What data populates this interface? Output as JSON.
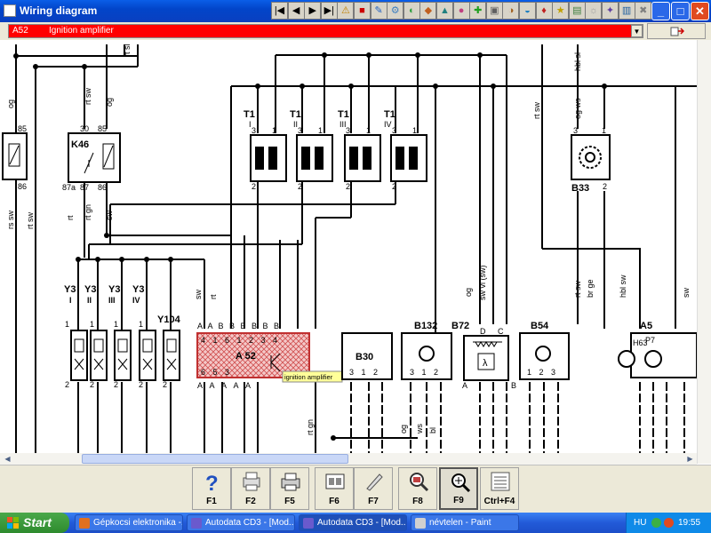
{
  "window": {
    "title": "Wiring diagram"
  },
  "toolbar": {
    "icons": [
      "first-icon",
      "prev-icon",
      "next-icon",
      "last-icon",
      "warning-icon",
      "book-icon",
      "tool-a-icon",
      "tool-b-icon",
      "tool-c-icon",
      "tool-d-icon",
      "tool-e-icon",
      "tool-f-icon",
      "tool-g-icon",
      "tool-h-icon",
      "tool-i-icon",
      "tool-j-icon",
      "tool-k-icon",
      "tool-l-icon",
      "tool-m-icon",
      "tool-n-icon",
      "tool-o-icon",
      "tool-p-icon",
      "tool-q-icon"
    ]
  },
  "selector": {
    "code": "A52",
    "label": "Ignition amplifier"
  },
  "diagram": {
    "tooltip": "ignition amplifier",
    "components": {
      "k46": "K46",
      "t1a": "T1",
      "t1a_sub": "I",
      "t1b": "T1",
      "t1b_sub": "II",
      "t1c": "T1",
      "t1c_sub": "III",
      "t1d": "T1",
      "t1d_sub": "IV",
      "b33": "B33",
      "y3a": "Y3",
      "y3a_sub": "I",
      "y3b": "Y3",
      "y3b_sub": "II",
      "y3c": "Y3",
      "y3c_sub": "III",
      "y3d": "Y3",
      "y3d_sub": "IV",
      "y104": "Y104",
      "a52": "A 52",
      "b30": "B30",
      "b132": "B132",
      "b72": "B72",
      "b54": "B54",
      "a5": "A5",
      "h63": "H63",
      "p7": "P7"
    },
    "wires": {
      "og1": "og",
      "rtsw1": "rt sw",
      "og2": "og",
      "rssw": "rs sw",
      "rtsw2": "rt sw",
      "rt1": "rt",
      "rtgn": "rt gn",
      "sw1": "sw",
      "sw2": "sw",
      "rt2": "rt",
      "rtgn2": "rt gn",
      "rtsl": "rt sl",
      "og3": "og",
      "swvi": "sw vi (sw)",
      "rtsw3": "rt sw",
      "hblsl": "hbl sl",
      "ogws": "og ws",
      "rtsw4": "rt sw",
      "brge": "br ge",
      "hblsw": "hbl sw",
      "sw3": "sw",
      "og4": "og",
      "ws": "ws",
      "bl": "bl"
    },
    "pins": {
      "k46_30": "30",
      "k46_85": "85",
      "k46_87a": "87a",
      "k46_87": "87",
      "k46_86": "86",
      "left_85": "85",
      "left_86": "86",
      "t_3": "3",
      "t_1": "1",
      "t_2": "2",
      "b33_3": "3",
      "b33_1": "1",
      "b33_2": "2",
      "a52_top": "A A B B B B B B",
      "a52_nums": "4 1 6 1 2 3 4",
      "a52_bot": "6 5 3",
      "a52_bot2": "A A A A A",
      "b72_d": "D",
      "b72_c": "C",
      "b72_a": "A",
      "b72_b": "B",
      "b30_nums": "3 1 2",
      "b132_nums": "3 1 2",
      "b54_nums": "1 2 3",
      "y_pin1": "1",
      "y_pin2": "2"
    }
  },
  "fkeys": [
    {
      "label": "F1",
      "icon": "help-icon"
    },
    {
      "label": "F2",
      "icon": "printer-setup-icon"
    },
    {
      "label": "F5",
      "icon": "print-icon"
    },
    {
      "label": "F6",
      "icon": "component-icon"
    },
    {
      "label": "F7",
      "icon": "pen-icon"
    },
    {
      "label": "F8",
      "icon": "zoom-search-icon"
    },
    {
      "label": "F9",
      "icon": "zoom-fit-icon"
    },
    {
      "label": "Ctrl+F4",
      "icon": "close-doc-icon"
    }
  ],
  "taskbar": {
    "start": "Start",
    "tasks": [
      "Gépkocsi elektronika -...",
      "Autodata CD3 - [Mod...",
      "Autodata CD3 - [Mod...",
      "névtelen - Paint"
    ],
    "lang": "HU",
    "clock": "19:55"
  },
  "colors": {
    "titlebar": "#0a4fd4",
    "selector_bg": "#ff0000",
    "highlight": "#d05050",
    "tooltip_bg": "#ffff99"
  }
}
